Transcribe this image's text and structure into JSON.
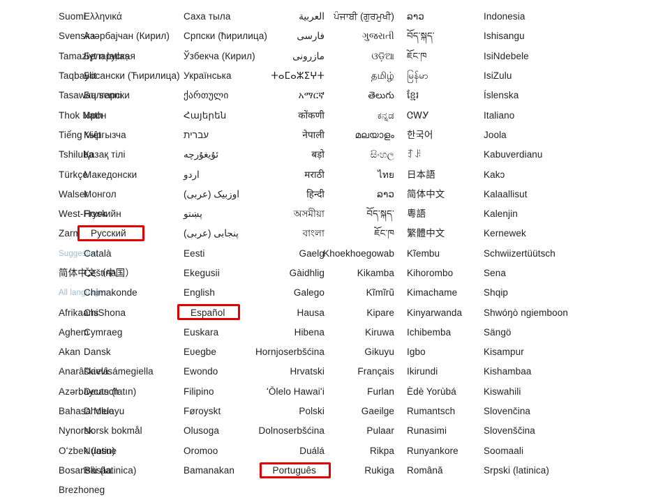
{
  "screen": {
    "title": "Language selection grid",
    "background_color": "#ffffff",
    "text_color": "#202124",
    "section_label_color": "#9bbfd4",
    "highlight_color": "#e00000"
  },
  "columns": [
    {
      "name": "column-1",
      "items": [
        {
          "label": "Suomi"
        },
        {
          "label": "Svenska"
        },
        {
          "label": "Tamaziɣt n laṭlaṣ"
        },
        {
          "label": "Taqbaylit"
        },
        {
          "label": "Tasawaq senni"
        },
        {
          "label": "Thok Nath"
        },
        {
          "label": "Tiếng Việt"
        },
        {
          "label": "Tshiluba"
        },
        {
          "label": "Türkçe"
        },
        {
          "label": "Walser"
        },
        {
          "label": "West-Frysk"
        },
        {
          "label": "Zarmaciine"
        },
        {
          "label": "Suggested",
          "type": "section"
        },
        {
          "label": "简体中文（中国）"
        },
        {
          "label": "All languages",
          "type": "section"
        },
        {
          "label": "Afrikaans"
        },
        {
          "label": "Aghem"
        },
        {
          "label": "Akan"
        },
        {
          "label": "Anarâškielâ"
        },
        {
          "label": "Azərbaycan (latın)"
        },
        {
          "label": "Bahasa Melayu"
        },
        {
          "label": "Nynorsk"
        },
        {
          "label": "Oʻzbek (lotin)"
        },
        {
          "label": "Bosanski (latinica)"
        },
        {
          "label": "Brezhoneg"
        }
      ]
    },
    {
      "name": "column-2",
      "items": [
        {
          "label": "Ελληνικά"
        },
        {
          "label": "Aзәрбајчан (Кирил)"
        },
        {
          "label": "Беларуская"
        },
        {
          "label": "Босански (Ћирилица)"
        },
        {
          "label": "Български"
        },
        {
          "label": "Ирон"
        },
        {
          "label": "Кыргызча"
        },
        {
          "label": "Қазақ тілі"
        },
        {
          "label": "Македонски"
        },
        {
          "label": "Монгол"
        },
        {
          "label": "Нохчийн"
        },
        {
          "label": "Русский",
          "highlighted": true,
          "highlight_width": 96
        },
        {
          "label": "Català"
        },
        {
          "label": "Čeština"
        },
        {
          "label": "Chimakonde"
        },
        {
          "label": "ChiShona"
        },
        {
          "label": "Cymraeg"
        },
        {
          "label": "Dansk"
        },
        {
          "label": "Davvisámegiella"
        },
        {
          "label": "Deutsch"
        },
        {
          "label": "Dholuo"
        },
        {
          "label": "Norsk bokmål"
        },
        {
          "label": "Nuasue"
        },
        {
          "label": "Ɓàsàa"
        }
      ]
    },
    {
      "name": "column-3",
      "items": [
        {
          "label": "Саха тыла"
        },
        {
          "label": "Српски (ћирилица)"
        },
        {
          "label": "Ўзбекча (Кирил)"
        },
        {
          "label": "Українська"
        },
        {
          "label": "ქართული"
        },
        {
          "label": "Հայերեն"
        },
        {
          "label": "עברית"
        },
        {
          "label": "ئۇيغۇرچە"
        },
        {
          "label": "اردو"
        },
        {
          "label": "اوزبیک (عربی)"
        },
        {
          "label": "پښتو"
        },
        {
          "label": "پنجابی (عربی)"
        },
        {
          "label": "Eesti"
        },
        {
          "label": "Ekegusii"
        },
        {
          "label": "English"
        },
        {
          "label": "Español",
          "highlighted": true,
          "highlight_width": 90
        },
        {
          "label": "Euskara"
        },
        {
          "label": "Eʋegbe"
        },
        {
          "label": "Ewondo"
        },
        {
          "label": "Filipino"
        },
        {
          "label": "Føroyskt"
        },
        {
          "label": "Olusoga"
        },
        {
          "label": "Oromoo"
        },
        {
          "label": "Bamanakan"
        }
      ]
    },
    {
      "name": "column-4",
      "items": [
        {
          "label": "العربية",
          "rtl": true
        },
        {
          "label": "فارسی",
          "rtl": true
        },
        {
          "label": "مازرونی",
          "rtl": true
        },
        {
          "label": "ⵜⴰⵎⴰⵣⵉⵖⵜ"
        },
        {
          "label": "አማርኛ"
        },
        {
          "label": "कोंकणी"
        },
        {
          "label": "नेपाली"
        },
        {
          "label": "बड़ो"
        },
        {
          "label": "मराठी"
        },
        {
          "label": "हिन्दी"
        },
        {
          "label": "অসমীয়া"
        },
        {
          "label": "বাংলা"
        },
        {
          "label": "Gaelg"
        },
        {
          "label": "Gàidhlig"
        },
        {
          "label": "Galego"
        },
        {
          "label": "Hausa"
        },
        {
          "label": "Hibena"
        },
        {
          "label": "Hornjoserbšćina"
        },
        {
          "label": "Hrvatski"
        },
        {
          "label": "ʻŌlelo Hawaiʻi"
        },
        {
          "label": "Polski"
        },
        {
          "label": "Dolnoserbšćina"
        },
        {
          "label": "Duálá"
        },
        {
          "label": "Português",
          "highlighted": true,
          "highlight_width": 102
        }
      ]
    },
    {
      "name": "column-5",
      "items": [
        {
          "label": "ਪੰਜਾਬੀ (ਗੁਰਮੁਖੀ)"
        },
        {
          "label": "ગુજરાતી"
        },
        {
          "label": "ଓଡ଼ିଆ"
        },
        {
          "label": "தமிழ்"
        },
        {
          "label": "తెలుగు"
        },
        {
          "label": "ಕನ್ನಡ"
        },
        {
          "label": "മലയാളം"
        },
        {
          "label": "සිංහල"
        },
        {
          "label": "ไทย"
        },
        {
          "label": "ລາວ"
        },
        {
          "label": "བོད་སྐད་"
        },
        {
          "label": "ཇོང་ཁ"
        },
        {
          "label": "Khoekhoegowab"
        },
        {
          "label": "Kikamba"
        },
        {
          "label": "Kĩmĩrũ"
        },
        {
          "label": "Kipare"
        },
        {
          "label": "Kiruwa"
        },
        {
          "label": "Gikuyu"
        },
        {
          "label": "Français"
        },
        {
          "label": "Furlan"
        },
        {
          "label": "Gaeilge"
        },
        {
          "label": "Pulaar"
        },
        {
          "label": "Rikpa"
        },
        {
          "label": "Rukiga"
        }
      ]
    },
    {
      "name": "column-6",
      "items": [
        {
          "label": "ລາວ"
        },
        {
          "label": "བོད་སྐད་"
        },
        {
          "label": "ཇོང་ཁ"
        },
        {
          "label": "မြန်မာ"
        },
        {
          "label": "ខ្មែរ"
        },
        {
          "label": "ᏣᎳᎩ"
        },
        {
          "label": "한국어"
        },
        {
          "label": "ꆈꌠ"
        },
        {
          "label": "日本語"
        },
        {
          "label": "简体中文"
        },
        {
          "label": "粵語"
        },
        {
          "label": "繁體中文"
        },
        {
          "label": "Kĩembu"
        },
        {
          "label": "Kihorombo"
        },
        {
          "label": "Kimachame"
        },
        {
          "label": "Kinyarwanda"
        },
        {
          "label": "Ichibemba"
        },
        {
          "label": "Igbo"
        },
        {
          "label": "Ikirundi"
        },
        {
          "label": "Èdè Yorùbá"
        },
        {
          "label": "Rumantsch"
        },
        {
          "label": "Runasimi"
        },
        {
          "label": "Runyankore"
        },
        {
          "label": "Română"
        }
      ]
    },
    {
      "name": "column-7",
      "items": [
        {
          "label": "Indonesia"
        },
        {
          "label": "Ishisangu"
        },
        {
          "label": "IsiNdebele"
        },
        {
          "label": "IsiZulu"
        },
        {
          "label": "Íslenska"
        },
        {
          "label": "Italiano"
        },
        {
          "label": "Joola"
        },
        {
          "label": "Kabuverdianu"
        },
        {
          "label": "Kakɔ"
        },
        {
          "label": "Kalaallisut"
        },
        {
          "label": "Kalenjin"
        },
        {
          "label": "Kernewek"
        },
        {
          "label": "Schwiizertüütsch"
        },
        {
          "label": "Sena"
        },
        {
          "label": "Shqip"
        },
        {
          "label": "Shwóŋò ngiemboon"
        },
        {
          "label": "Sängö"
        },
        {
          "label": "Kisampur"
        },
        {
          "label": "Kishambaa"
        },
        {
          "label": "Kiswahili"
        },
        {
          "label": "Slovenčina"
        },
        {
          "label": "Slovenščina"
        },
        {
          "label": "Soomaali"
        },
        {
          "label": "Srpski (latinica)"
        }
      ]
    }
  ]
}
